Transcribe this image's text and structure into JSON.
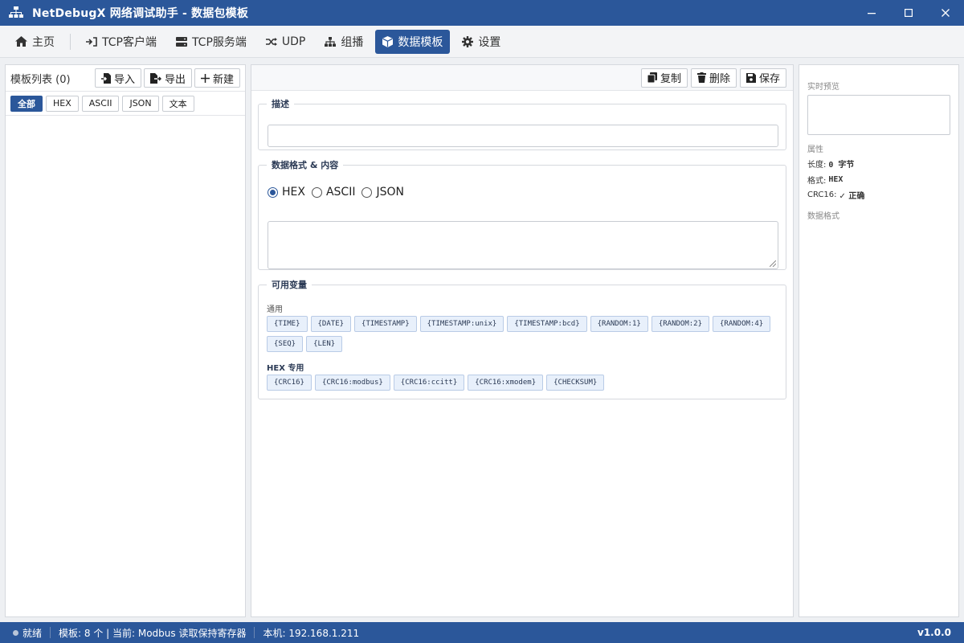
{
  "window": {
    "title": "NetDebugX 网络调试助手 - 数据包模板",
    "controls": {
      "minimize": "—",
      "maximize": "□",
      "close": "✕"
    }
  },
  "tabs": [
    {
      "label": "主页",
      "icon": "home-icon"
    },
    {
      "label": "TCP客户端",
      "icon": "sign-in-icon"
    },
    {
      "label": "TCP服务端",
      "icon": "server-icon"
    },
    {
      "label": "UDP",
      "icon": "shuffle-icon"
    },
    {
      "label": "组播",
      "icon": "sitemap-icon"
    },
    {
      "label": "数据模板",
      "icon": "cube-icon",
      "active": true
    },
    {
      "label": "设置",
      "icon": "gear-icon"
    }
  ],
  "left_panel": {
    "title": "模板列表 (0)",
    "import_label": "导入",
    "export_label": "导出",
    "new_label": "新建",
    "filters": [
      {
        "label": "全部",
        "active": true
      },
      {
        "label": "HEX"
      },
      {
        "label": "ASCII"
      },
      {
        "label": "JSON"
      },
      {
        "label": "文本"
      }
    ]
  },
  "editor": {
    "toolbar": {
      "copy_label": "复制",
      "delete_label": "删除",
      "save_label": "保存"
    },
    "description": {
      "legend": "描述",
      "value": ""
    },
    "format": {
      "legend": "数据格式 & 内容",
      "options": [
        "HEX",
        "ASCII",
        "JSON"
      ],
      "selected": "HEX",
      "content": ""
    },
    "variables": {
      "legend": "可用变量",
      "general_label": "通用",
      "general_row1": [
        "{TIME}",
        "{DATE}",
        "{TIMESTAMP}",
        "{TIMESTAMP:unix}",
        "{TIMESTAMP:bcd}",
        "{RANDOM:1}",
        "{RANDOM:2}",
        "{RANDOM:4}"
      ],
      "general_row2": [
        "{SEQ}",
        "{LEN}"
      ],
      "hex_label": "HEX 专用",
      "hex_vars": [
        "{CRC16}",
        "{CRC16:modbus}",
        "{CRC16:ccitt}",
        "{CRC16:xmodem}",
        "{CHECKSUM}"
      ]
    }
  },
  "right_panel": {
    "preview_label": "实时预览",
    "props_label": "属性",
    "length_label": "长度:",
    "length_value": "0 字节",
    "format_label": "格式:",
    "format_value": "HEX",
    "crc_label": "CRC16:",
    "crc_value": "✓ 正确",
    "data_format_label": "数据格式"
  },
  "status": {
    "state": "就绪",
    "templates": "模板: 8 个 | 当前: Modbus 读取保持寄存器",
    "local": "本机: 192.168.1.211",
    "version": "v1.0.0"
  },
  "colors": {
    "accent": "#2b579a",
    "chip_bg": "#e8f0fb"
  }
}
